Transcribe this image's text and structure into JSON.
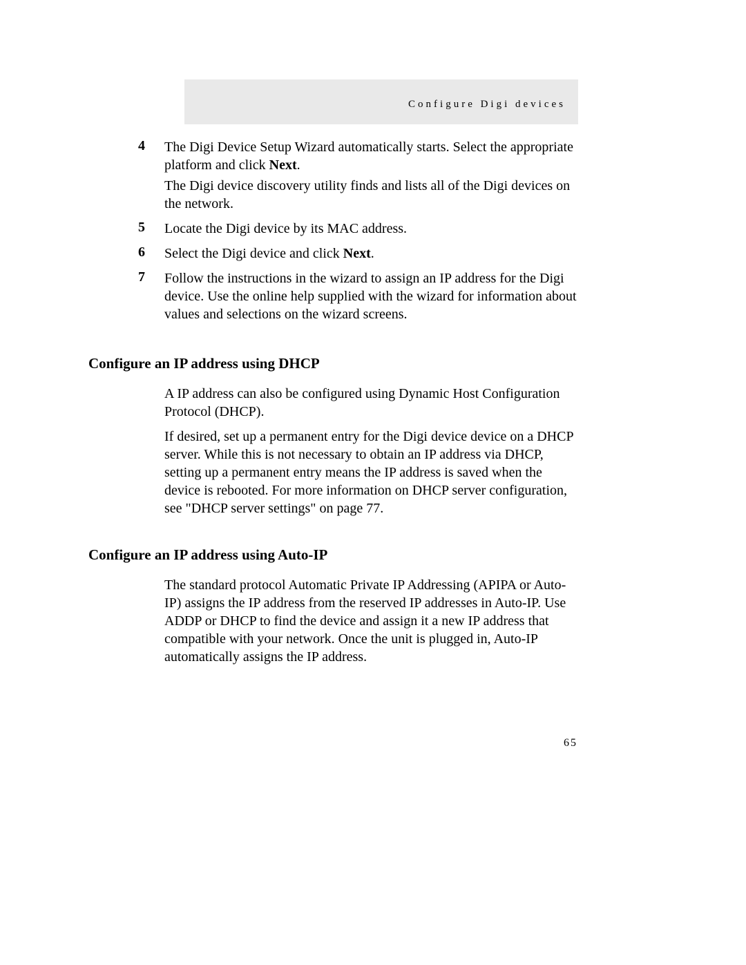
{
  "header": {
    "running_title": "Configure Digi devices"
  },
  "steps": [
    {
      "number": "4",
      "paragraphs": [
        {
          "text_before": "The Digi Device Setup Wizard automatically starts. Select the appropriate platform and click ",
          "bold": "Next",
          "text_after": "."
        },
        {
          "text_before": "The Digi device discovery utility finds and lists all of the Digi devices on the network.",
          "bold": "",
          "text_after": ""
        }
      ]
    },
    {
      "number": "5",
      "paragraphs": [
        {
          "text_before": "Locate the Digi device by its MAC address.",
          "bold": "",
          "text_after": ""
        }
      ]
    },
    {
      "number": "6",
      "paragraphs": [
        {
          "text_before": "Select the Digi device and click ",
          "bold": "Next",
          "text_after": "."
        }
      ]
    },
    {
      "number": "7",
      "paragraphs": [
        {
          "text_before": "Follow the instructions in the wizard to assign an IP address for the Digi device. Use the online help supplied with the wizard for information about values and selections on the wizard screens.",
          "bold": "",
          "text_after": ""
        }
      ]
    }
  ],
  "sections": [
    {
      "heading": "Configure an IP address using DHCP",
      "paragraphs": [
        "A IP address can also be configured using Dynamic Host Configuration Protocol (DHCP).",
        "If desired, set up a permanent entry for the Digi device device on a DHCP server. While this is not necessary to obtain an IP address via DHCP, setting up a permanent entry means the IP address is saved when the device is rebooted. For more information on DHCP server configuration, see \"DHCP server settings\" on page 77."
      ]
    },
    {
      "heading": "Configure an IP address using Auto-IP",
      "paragraphs": [
        "The standard protocol Automatic Private IP Addressing (APIPA or Auto-IP) assigns the IP address from the reserved IP addresses in Auto-IP. Use ADDP or DHCP to find the device and assign it a new IP address that compatible with your network. Once the unit is plugged in, Auto-IP automatically assigns the IP address."
      ]
    }
  ],
  "page_number": "65"
}
